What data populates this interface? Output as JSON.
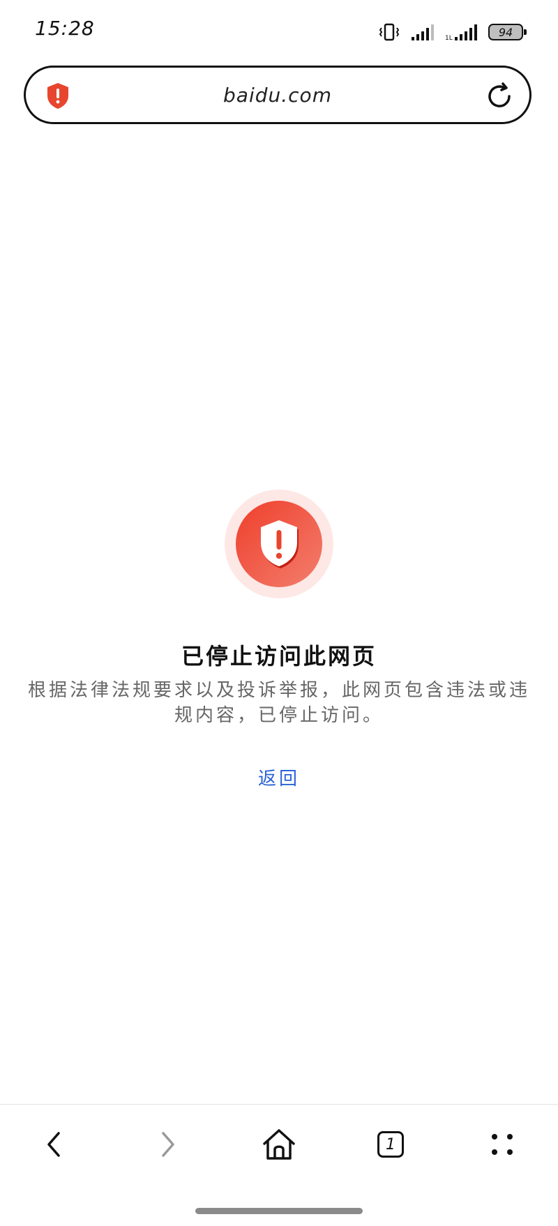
{
  "status_bar": {
    "time": "15:28",
    "battery": "94",
    "icons": [
      "vibrate-icon",
      "signal-icon",
      "signal-icon-2",
      "battery-icon"
    ]
  },
  "address_bar": {
    "url": "baidu.com",
    "security_icon": "warning-shield-icon",
    "refresh_icon": "refresh-icon"
  },
  "warning": {
    "icon": "warning-shield-icon",
    "title": "已停止访问此网页",
    "description": "根据法律法规要求以及投诉举报，此网页包含违法或违规内容，已停止访问。",
    "back_label": "返回"
  },
  "bottom_nav": {
    "items": [
      "back-icon",
      "forward-icon",
      "home-icon",
      "tabs-icon",
      "menu-icon"
    ],
    "tab_count": "1"
  },
  "colors": {
    "accent_red": "#e8452f",
    "link_blue": "#2a63d6"
  }
}
